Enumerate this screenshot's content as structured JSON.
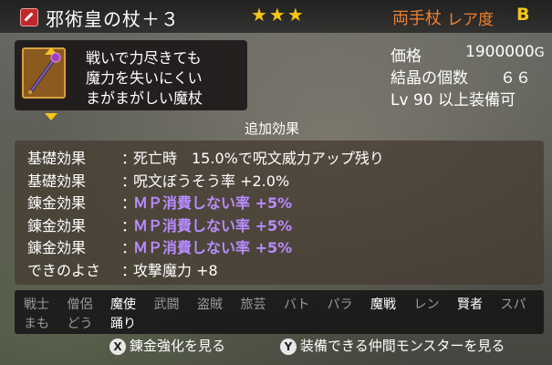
{
  "header": {
    "item_name": "邪術皇の杖＋３",
    "stars": "★★★",
    "hand_type": "両手杖",
    "rarity_label": "レア度",
    "rarity_value": "B"
  },
  "description": [
    "戦いで力尽きても",
    "魔力を失いにくい",
    "まがまがしい魔杖"
  ],
  "stats": {
    "price_label": "価格",
    "price_value": "1900000",
    "price_unit": "G",
    "crystal_label": "結晶の個数",
    "crystal_value": "６６",
    "level_prefix": "Lv",
    "level_value": "90",
    "level_suffix": "以上装備可"
  },
  "effects_title": "追加効果",
  "effects": [
    {
      "label": "基礎効果",
      "value": "死亡時　15.0%で呪文威力アップ残り",
      "highlight": false
    },
    {
      "label": "基礎効果",
      "value": "呪文ぼうそう率 +2.0%",
      "highlight": false
    },
    {
      "label": "錬金効果",
      "value": "ＭＰ消費しない率 +5%",
      "highlight": true
    },
    {
      "label": "錬金効果",
      "value": "ＭＰ消費しない率 +5%",
      "highlight": true
    },
    {
      "label": "錬金効果",
      "value": "ＭＰ消費しない率 +5%",
      "highlight": true
    },
    {
      "label": "できのよさ",
      "value": "攻撃魔力 +8",
      "highlight": false
    }
  ],
  "jobs_row1": [
    {
      "name": "戦士",
      "on": false
    },
    {
      "name": "僧侶",
      "on": false
    },
    {
      "name": "魔使",
      "on": true
    },
    {
      "name": "武闘",
      "on": false
    },
    {
      "name": "盗賊",
      "on": false
    },
    {
      "name": "旅芸",
      "on": false
    },
    {
      "name": "バト",
      "on": false
    },
    {
      "name": "パラ",
      "on": false
    },
    {
      "name": "魔戦",
      "on": true
    },
    {
      "name": "レン",
      "on": false
    },
    {
      "name": "賢者",
      "on": true
    },
    {
      "name": "スパ",
      "on": false
    }
  ],
  "jobs_row2": [
    {
      "name": "まも",
      "on": false
    },
    {
      "name": "どう",
      "on": false
    },
    {
      "name": "踊り",
      "on": true
    }
  ],
  "footer": {
    "x_button": "X",
    "x_label": "錬金強化を見る",
    "y_button": "Y",
    "y_label": "装備できる仲間モンスターを見る"
  },
  "colors": {
    "accent_orange": "#f08030",
    "gold": "#f5c518",
    "effect_purple": "#b88cff"
  }
}
